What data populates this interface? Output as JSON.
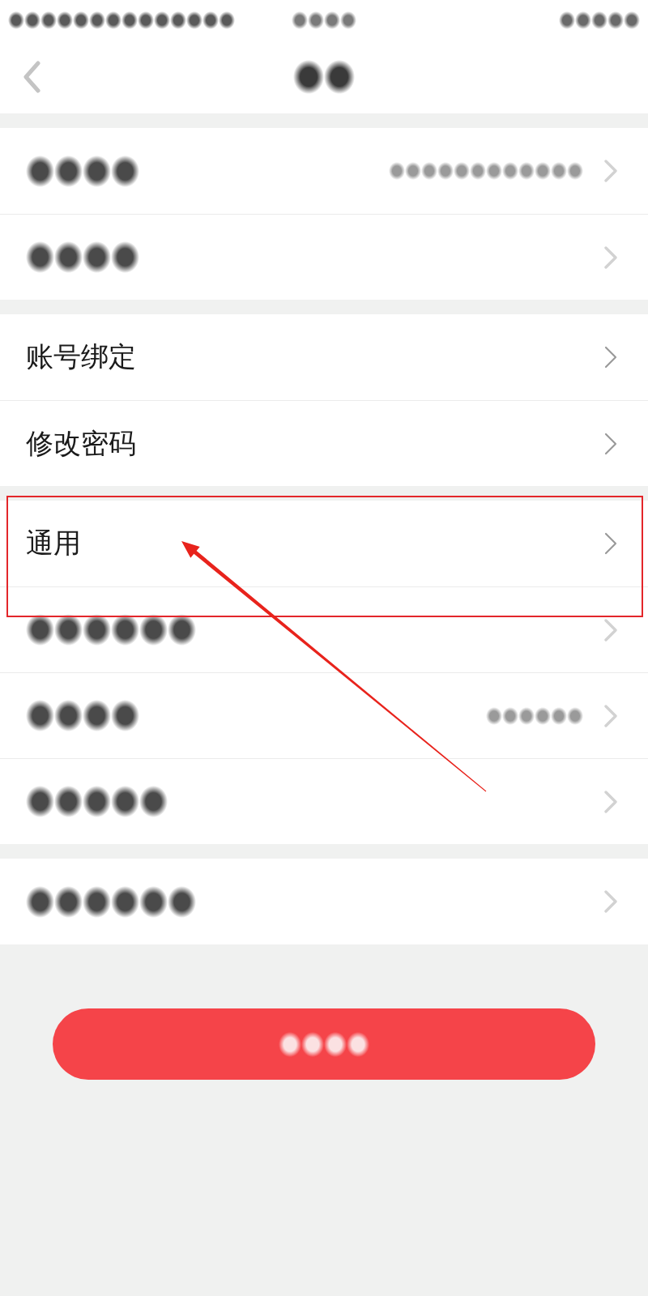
{
  "status_bar": {
    "blurred": true
  },
  "nav_bar": {
    "back_button": true,
    "title_blurred": true
  },
  "sections": [
    {
      "rows": [
        {
          "kind": "blurred",
          "has_value": true,
          "highlighted": false
        },
        {
          "kind": "blurred",
          "has_value": false,
          "highlighted": false
        }
      ]
    },
    {
      "rows": [
        {
          "kind": "text",
          "label": "账号绑定",
          "highlighted": false
        },
        {
          "kind": "text",
          "label": "修改密码",
          "highlighted": false
        }
      ]
    },
    {
      "rows": [
        {
          "kind": "text",
          "label": "通用",
          "highlighted": true
        },
        {
          "kind": "blurred",
          "has_value": false,
          "highlighted": false
        },
        {
          "kind": "blurred",
          "has_value": true,
          "highlighted": false
        },
        {
          "kind": "blurred",
          "has_value": false,
          "highlighted": false
        }
      ]
    },
    {
      "rows": [
        {
          "kind": "blurred",
          "has_value": false,
          "highlighted": false
        }
      ]
    }
  ],
  "bottom_button": {
    "label_blurred": true
  }
}
